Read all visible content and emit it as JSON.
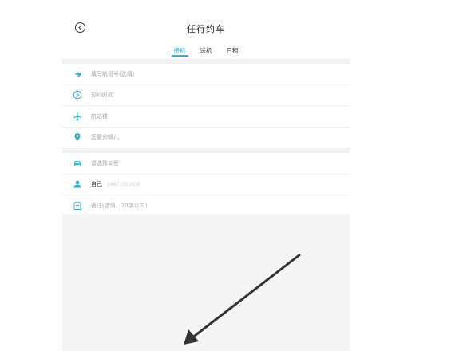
{
  "header": {
    "title": "任行约车",
    "back_icon": "back-circle-icon"
  },
  "tabs": [
    {
      "label": "接机",
      "active": true
    },
    {
      "label": "送机",
      "active": false
    },
    {
      "label": "日租",
      "active": false
    }
  ],
  "form": {
    "flight_placeholder": "填写航班号(选填)",
    "time_placeholder": "预约时间",
    "terminal_placeholder": "航站楼",
    "destination_placeholder": "您要去哪儿",
    "car_type_placeholder": "请选择车型",
    "passenger_label": "自己",
    "passenger_phone": "18872312438",
    "remark_placeholder": "备注(选填，20字以内)"
  },
  "colors": {
    "accent": "#26b3d4",
    "background_gray": "#f4f4f4"
  }
}
